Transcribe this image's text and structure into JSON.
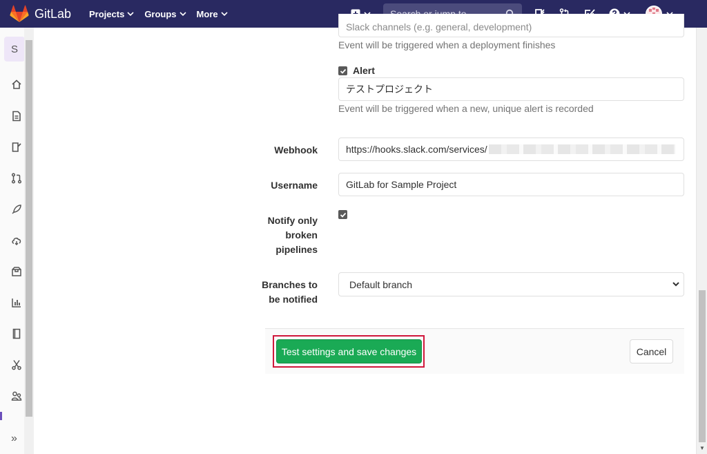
{
  "topbar": {
    "brand": "GitLab",
    "nav": [
      "Projects",
      "Groups",
      "More"
    ],
    "search_placeholder": "Search or jump to..."
  },
  "sidebar": {
    "project_initial": "S",
    "icons": [
      "home-icon",
      "document-icon",
      "issues-icon",
      "merge-request-icon",
      "rocket-icon",
      "cloud-icon",
      "package-icon",
      "analytics-icon",
      "wiki-icon",
      "snippets-icon",
      "members-icon"
    ],
    "collapse_glyph": "»"
  },
  "form": {
    "top_field_value": "Slack channels (e.g. general, development)",
    "deployment_help": "Event will be triggered when a deployment finishes",
    "alert_label": "Alert",
    "alert_value": "テストプロジェクト",
    "alert_help": "Event will be triggered when a new, unique alert is recorded",
    "webhook_label": "Webhook",
    "webhook_value": "https://hooks.slack.com/services/",
    "username_label": "Username",
    "username_value": "GitLab for Sample Project",
    "notify_label_1": "Notify only",
    "notify_label_2": "broken",
    "notify_label_3": "pipelines",
    "branches_label_1": "Branches to",
    "branches_label_2": "be notified",
    "branches_value": "Default branch"
  },
  "actions": {
    "save_label": "Test settings and save changes",
    "cancel_label": "Cancel"
  },
  "colors": {
    "topbar": "#292961",
    "save_button": "#1aaa55",
    "highlight": "#d0173b"
  }
}
